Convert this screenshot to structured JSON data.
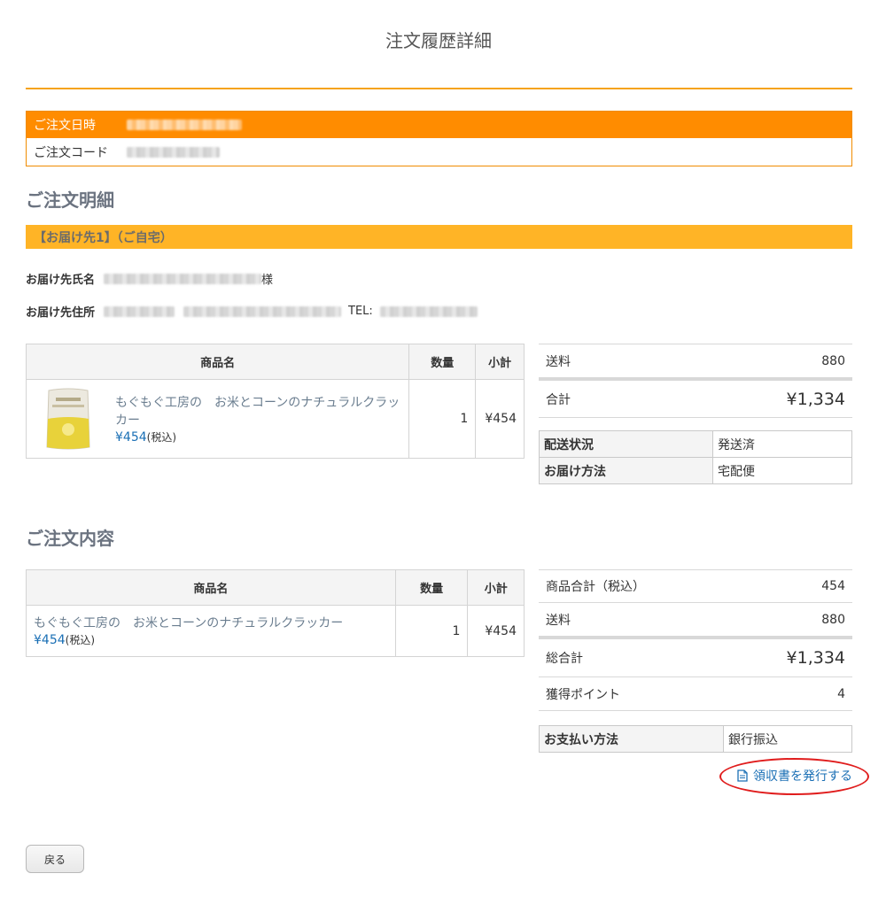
{
  "page": {
    "title": "注文履歴詳細"
  },
  "order_info": {
    "date_label": "ご注文日時",
    "code_label": "ご注文コード"
  },
  "order_details": {
    "heading": "ご注文明細",
    "destination_title": "【お届け先1】（ご自宅）",
    "recipient_label": "お届け先氏名",
    "recipient_suffix": "様",
    "address_label": "お届け先住所",
    "tel_label": "TEL:",
    "table": {
      "headers": [
        "商品名",
        "数量",
        "小計"
      ],
      "rows": [
        {
          "name": "もぐもぐ工房の　お米とコーンのナチュラルクラッカー",
          "price": "¥454",
          "tax_note": "(税込)",
          "qty": "1",
          "subtotal": "¥454"
        }
      ]
    },
    "summary": {
      "shipping_label": "送料",
      "shipping_value": "880",
      "total_label": "合計",
      "total_value": "¥1,334"
    },
    "status": {
      "shipping_status_label": "配送状況",
      "shipping_status_value": "発送済",
      "delivery_method_label": "お届け方法",
      "delivery_method_value": "宅配便"
    }
  },
  "order_contents": {
    "heading": "ご注文内容",
    "table": {
      "headers": [
        "商品名",
        "数量",
        "小計"
      ],
      "rows": [
        {
          "name": "もぐもぐ工房の　お米とコーンのナチュラルクラッカー",
          "price": "¥454",
          "tax_note": "(税込)",
          "qty": "1",
          "subtotal": "¥454"
        }
      ]
    },
    "summary": {
      "items_total_label": "商品合計（税込）",
      "items_total_value": "454",
      "shipping_label": "送料",
      "shipping_value": "880",
      "grand_total_label": "総合計",
      "grand_total_value": "¥1,334",
      "points_label": "獲得ポイント",
      "points_value": "4"
    },
    "payment": {
      "label": "お支払い方法",
      "value": "銀行振込"
    },
    "receipt_link": "領収書を発行する"
  },
  "back_button": "戻る",
  "icons": {
    "receipt": "document-icon"
  },
  "colors": {
    "accent_orange": "#ff8c00",
    "destination_bar": "#ffb426",
    "link_blue": "#1a6fb5",
    "annotation_red": "#e01c1c"
  }
}
